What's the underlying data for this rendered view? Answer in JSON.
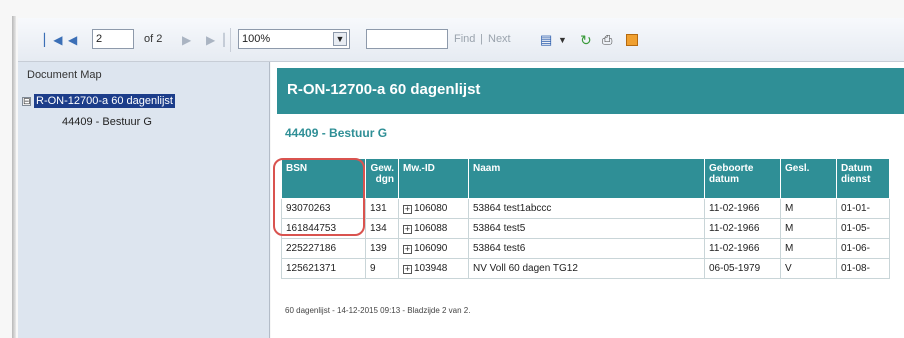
{
  "toolbar": {
    "current_page": "2",
    "page_total": "of 2",
    "zoom": "100%",
    "find_value": "",
    "find_label": "Find",
    "separator": "|",
    "next_label": "Next"
  },
  "docmap": {
    "header": "Document Map",
    "toggle": "⊟",
    "root": "R-ON-12700-a 60 dagenlijst",
    "child": "44409 - Bestuur G"
  },
  "report": {
    "title": "R-ON-12700-a 60 dagenlijst",
    "group": "44409 - Bestuur G",
    "columns": [
      "BSN",
      "Gew. dgn",
      "Mw.-ID",
      "Naam",
      "Geboorte datum",
      "Gesl.",
      "Datum dienst"
    ],
    "rows": [
      {
        "bsn": "93070263",
        "gew": "131",
        "mwid": "106080",
        "naam": "53864 test1abccc",
        "geb": "11-02-1966",
        "gesl": "M",
        "datum": "01-01-"
      },
      {
        "bsn": "161844753",
        "gew": "134",
        "mwid": "106088",
        "naam": "53864 test5",
        "geb": "11-02-1966",
        "gesl": "M",
        "datum": "01-05-"
      },
      {
        "bsn": "225227186",
        "gew": "139",
        "mwid": "106090",
        "naam": "53864 test6",
        "geb": "11-02-1966",
        "gesl": "M",
        "datum": "01-06-"
      },
      {
        "bsn": "125621371",
        "gew": "9",
        "mwid": "103948",
        "naam": "NV Voll 60 dagen TG12",
        "geb": "06-05-1979",
        "gesl": "V",
        "datum": "01-08-"
      }
    ],
    "footer": "60 dagenlijst - 14-12-2015 09:13 - Bladzijde 2 van 2."
  },
  "colors": {
    "accent": "#2f8f96",
    "highlight": "#d9534f",
    "selection": "#1c3d8a"
  }
}
